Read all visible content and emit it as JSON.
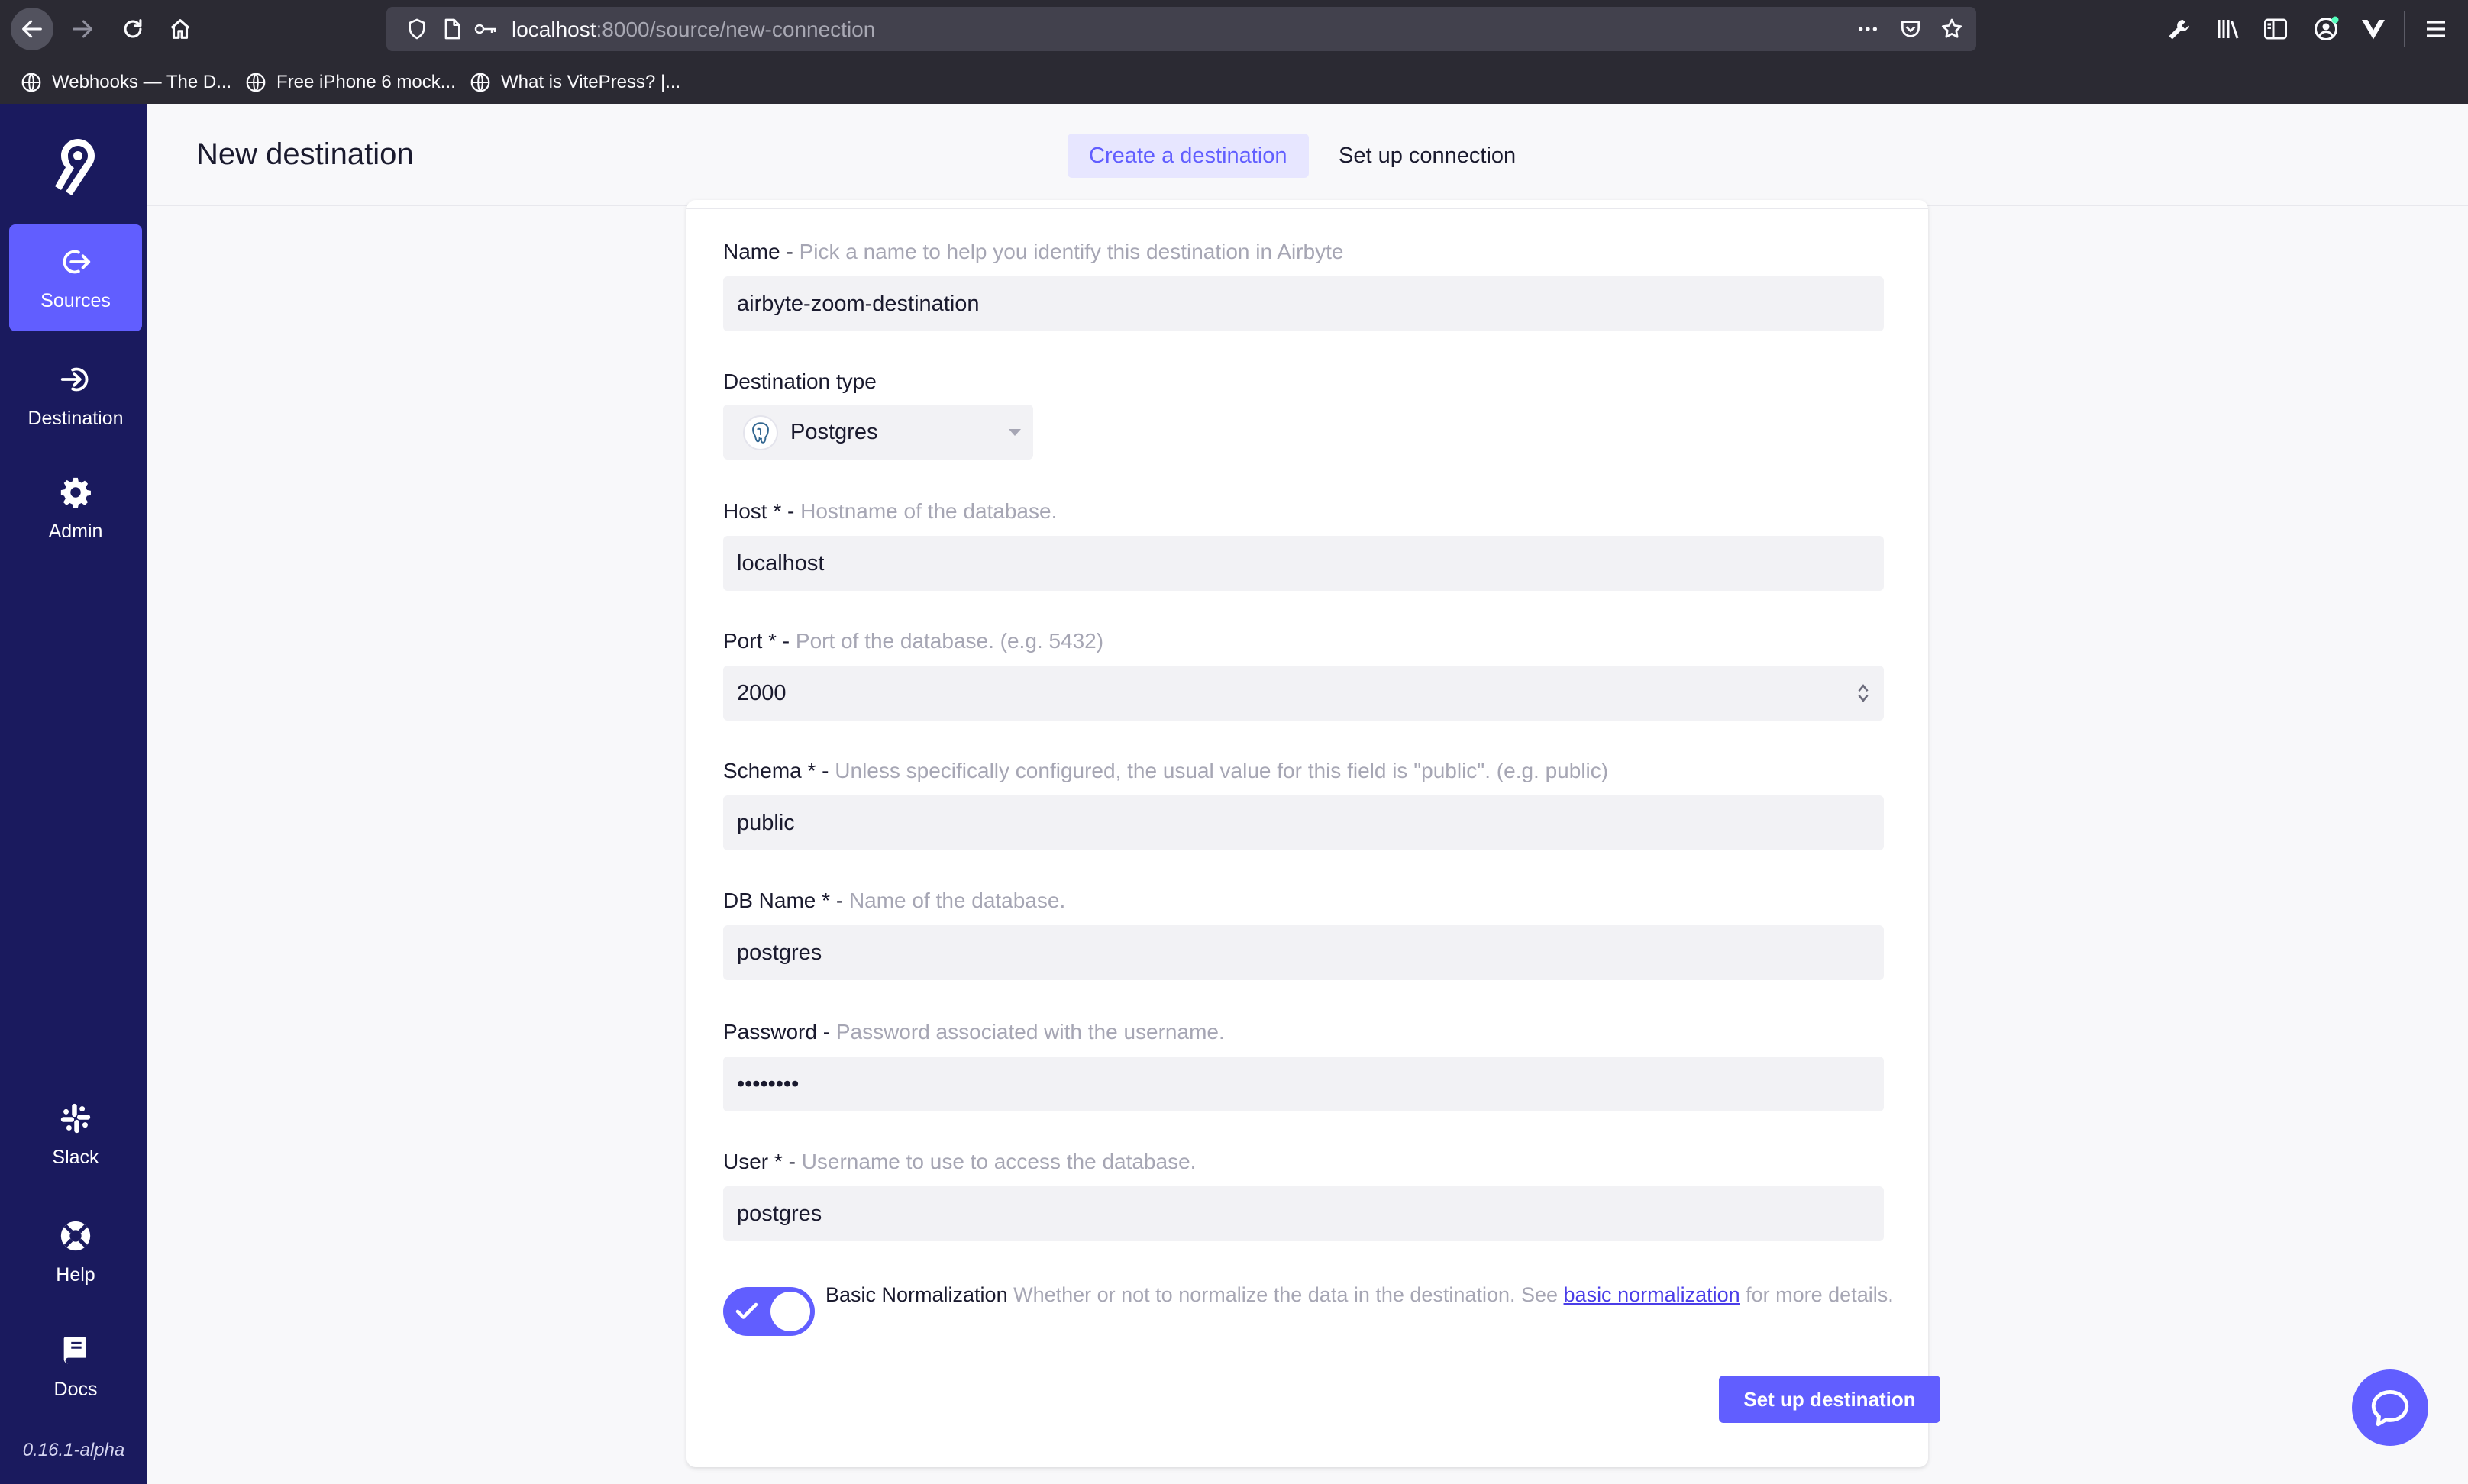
{
  "browser": {
    "url_host": "localhost",
    "url_path": ":8000/source/new-connection",
    "bookmarks": [
      {
        "label": "Webhooks — The D..."
      },
      {
        "label": "Free iPhone 6 mock..."
      },
      {
        "label": "What is VitePress? |..."
      }
    ]
  },
  "sidebar": {
    "items": [
      {
        "label": "Sources",
        "icon": "arrow-out-circle-icon",
        "active": true
      },
      {
        "label": "Destination",
        "icon": "arrow-in-circle-icon"
      },
      {
        "label": "Admin",
        "icon": "gear-icon"
      },
      {
        "label": "Slack",
        "icon": "slack-icon"
      },
      {
        "label": "Help",
        "icon": "lifebuoy-icon"
      },
      {
        "label": "Docs",
        "icon": "book-icon"
      }
    ],
    "version": "0.16.1-alpha"
  },
  "header": {
    "title": "New destination",
    "steps": [
      {
        "label": "Create a destination",
        "active": true
      },
      {
        "label": "Set up connection",
        "active": false
      }
    ]
  },
  "form": {
    "name": {
      "label": "Name - ",
      "hint": "Pick a name to help you identify this destination in Airbyte",
      "value": "airbyte-zoom-destination"
    },
    "destination_type": {
      "label": "Destination type",
      "value": "Postgres"
    },
    "host": {
      "label": "Host * - ",
      "hint": "Hostname of the database.",
      "value": "localhost"
    },
    "port": {
      "label": "Port * - ",
      "hint": "Port of the database. (e.g. 5432)",
      "value": "2000"
    },
    "schema": {
      "label": "Schema * - ",
      "hint": "Unless specifically configured, the usual value for this field is \"public\". (e.g. public)",
      "value": "public"
    },
    "db_name": {
      "label": "DB Name * - ",
      "hint": "Name of the database.",
      "value": "postgres"
    },
    "password": {
      "label": "Password - ",
      "hint": "Password associated with the username.",
      "value": "••••••••"
    },
    "user": {
      "label": "User * - ",
      "hint": "Username to use to access the database.",
      "value": "postgres"
    },
    "normalization": {
      "label": "Basic Normalization",
      "text_before": " Whether or not to normalize the data in the destination. See ",
      "link": "basic normalization",
      "text_after": " for more details.",
      "enabled": true
    },
    "submit_label": "Set up destination"
  },
  "colors": {
    "accent": "#615eff",
    "sidebar": "#1a1a5e"
  }
}
